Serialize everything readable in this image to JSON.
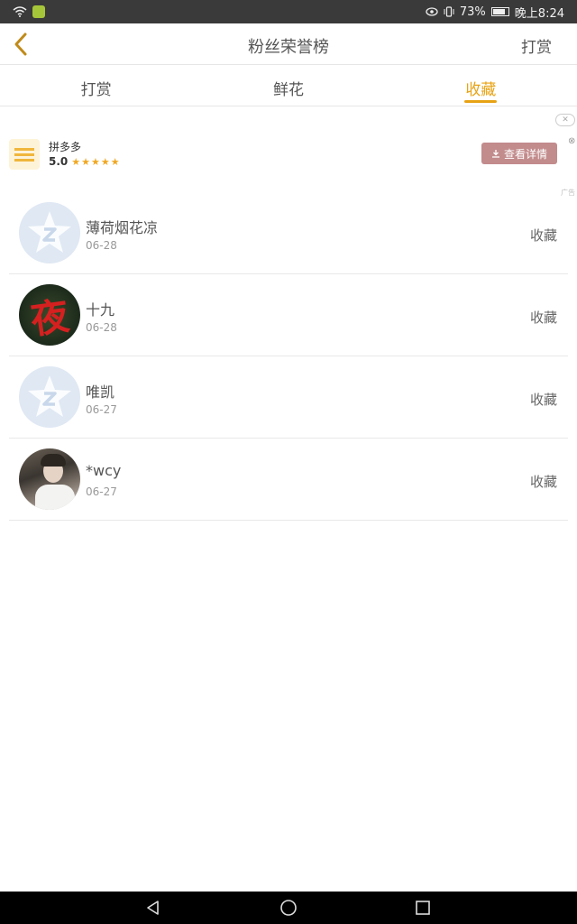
{
  "status_bar": {
    "battery": "73%",
    "time": "晚上8:24"
  },
  "nav": {
    "title": "粉丝荣誉榜",
    "action_label": "打赏"
  },
  "tabs": [
    {
      "label": "打赏",
      "active": false
    },
    {
      "label": "鲜花",
      "active": false
    },
    {
      "label": "收藏",
      "active": true
    }
  ],
  "ad": {
    "app_name": "拼多多",
    "rating": "5.0",
    "stars": "★★★★★",
    "button_label": "查看详情",
    "tag": "广告"
  },
  "list": [
    {
      "name": "薄荷烟花凉",
      "date": "06-28",
      "action": "收藏",
      "avatar": "default-avatar"
    },
    {
      "name": "十九",
      "date": "06-28",
      "action": "收藏",
      "avatar": "night-avatar"
    },
    {
      "name": "唯凯",
      "date": "06-27",
      "action": "收藏",
      "avatar": "default-avatar"
    },
    {
      "name": "*wcy",
      "date": "06-27",
      "action": "收藏",
      "avatar": "photo-avatar"
    }
  ],
  "avatar_glyph": "夜",
  "colors": {
    "accent": "#e8a315",
    "ad_button": "#c28b8c",
    "star": "#f0a824"
  }
}
